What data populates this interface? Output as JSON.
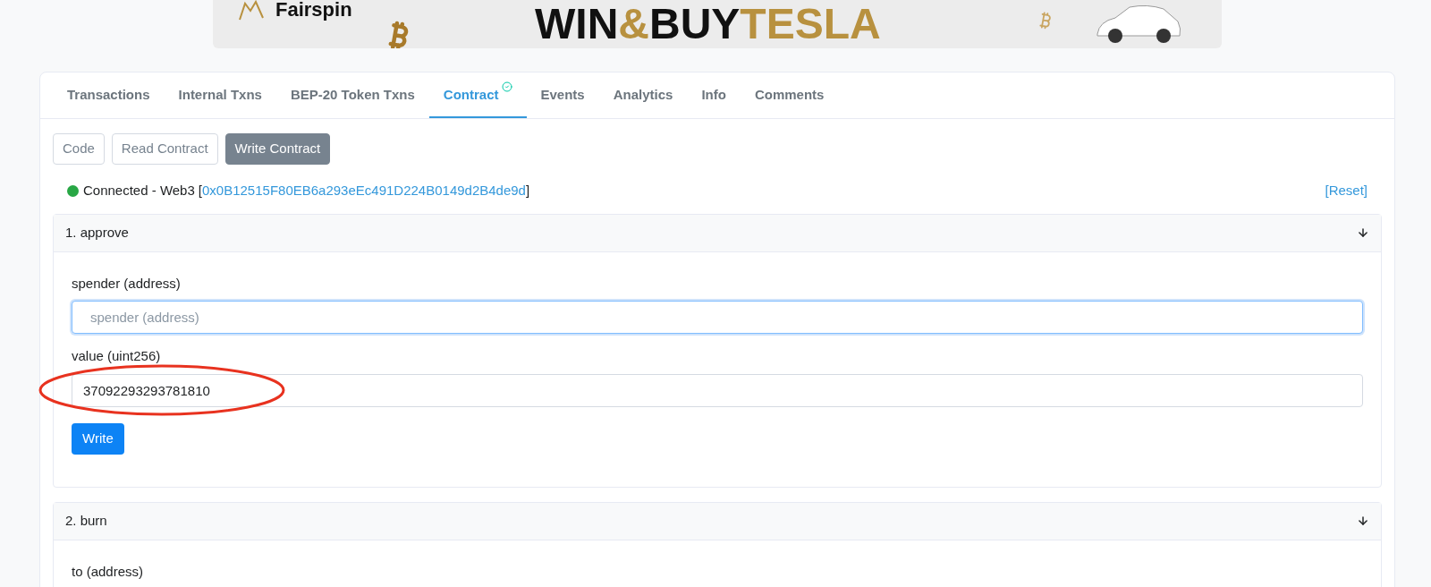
{
  "banner": {
    "brand": "Fairspin",
    "headline": [
      {
        "text": "WIN",
        "kind": "dark"
      },
      {
        "text": "&",
        "kind": "gold"
      },
      {
        "text": "BUY",
        "kind": "dark"
      },
      {
        "text": "TESLA",
        "kind": "gold"
      }
    ]
  },
  "tabs": [
    {
      "label": "Transactions",
      "selected": false,
      "verified": false
    },
    {
      "label": "Internal Txns",
      "selected": false,
      "verified": false
    },
    {
      "label": "BEP-20 Token Txns",
      "selected": false,
      "verified": false
    },
    {
      "label": "Contract",
      "selected": true,
      "verified": true
    },
    {
      "label": "Events",
      "selected": false,
      "verified": false
    },
    {
      "label": "Analytics",
      "selected": false,
      "verified": false
    },
    {
      "label": "Info",
      "selected": false,
      "verified": false
    },
    {
      "label": "Comments",
      "selected": false,
      "verified": false
    }
  ],
  "sub_tabs": [
    {
      "label": "Code",
      "selected": false
    },
    {
      "label": "Read Contract",
      "selected": false
    },
    {
      "label": "Write Contract",
      "selected": true
    }
  ],
  "connection": {
    "connected": true,
    "status": "Connected - Web3",
    "open_bracket": "[",
    "address": "0x0B12515F80EB6a293eEc491D224B0149d2B4de9d",
    "close_bracket": "]",
    "reset": "[Reset]"
  },
  "functions": [
    {
      "title": "1. approve",
      "expanded": true,
      "button": "Write",
      "fields": [
        {
          "label": "spender (address)",
          "placeholder": "spender (address)",
          "focused": true,
          "circled": false
        },
        {
          "label": "value (uint256)",
          "value": "37092293293781810",
          "focused": false,
          "circled": true
        }
      ]
    },
    {
      "title": "2. burn",
      "expanded": true,
      "fields": [
        {
          "label": "to (address)"
        }
      ]
    }
  ]
}
